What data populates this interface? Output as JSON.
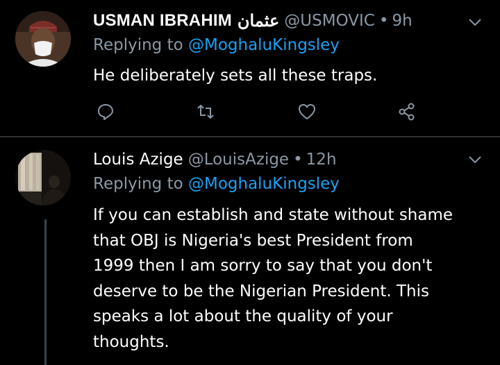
{
  "tweets": [
    {
      "display_name": "USMAN IBRAHIM",
      "display_name_arabic": "عثمان",
      "handle": "@USMOVIC",
      "separator": "•",
      "time": "9h",
      "replying_prefix": "Replying to",
      "replying_to": "@MoghaluKingsley",
      "body_lines": [
        "He deliberately sets all these traps."
      ],
      "actions": [
        "reply-icon",
        "retweet-icon",
        "like-icon",
        "share-icon"
      ]
    },
    {
      "display_name": "Louis Azige",
      "handle": "@LouisAzige",
      "separator": "•",
      "time": "12h",
      "replying_prefix": "Replying to",
      "replying_to": "@MoghaluKingsley",
      "body_lines": [
        "If you can establish and state without shame",
        "that OBJ is Nigeria's best President from",
        "1999 then I am sorry to say that you don't",
        "deserve to be the Nigerian President. This",
        "speaks a lot about the quality of your",
        "thoughts."
      ]
    }
  ],
  "colors": {
    "background": "#000000",
    "text": "#ffffff",
    "secondary": "#8b98a5",
    "accent": "#1da1f2",
    "divider": "#2f3336"
  }
}
